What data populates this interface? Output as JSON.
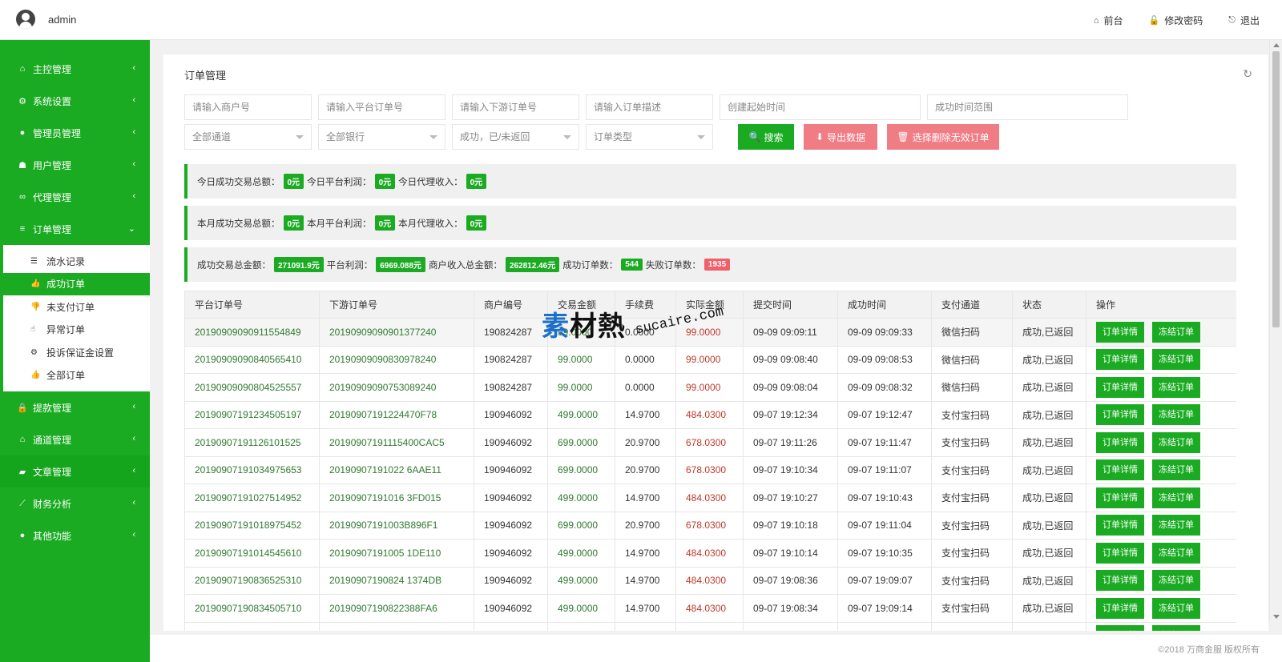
{
  "header": {
    "username": "admin",
    "links": [
      {
        "label": "前台",
        "icon": "home-icon"
      },
      {
        "label": "修改密码",
        "icon": "lock-icon"
      },
      {
        "label": "退出",
        "icon": "logout-icon"
      }
    ]
  },
  "sidebar": {
    "items": [
      {
        "label": "主控管理",
        "icon": "home-icon"
      },
      {
        "label": "系统设置",
        "icon": "gears-icon"
      },
      {
        "label": "管理员管理",
        "icon": "user-circle-icon"
      },
      {
        "label": "用户管理",
        "icon": "users-icon"
      },
      {
        "label": "代理管理",
        "icon": "handshake-icon"
      },
      {
        "label": "订单管理",
        "icon": "list-icon"
      },
      {
        "label": "提款管理",
        "icon": "lock-icon"
      },
      {
        "label": "通道管理",
        "icon": "bank-icon"
      },
      {
        "label": "文章管理",
        "icon": "book-icon"
      },
      {
        "label": "财务分析",
        "icon": "line-chart-icon"
      },
      {
        "label": "其他功能",
        "icon": "user-circle-icon"
      }
    ],
    "submenu": [
      {
        "label": "流水记录",
        "icon": "list-alt-icon"
      },
      {
        "label": "成功订单",
        "icon": "thumbs-up-icon"
      },
      {
        "label": "未支付订单",
        "icon": "thumbs-down-icon"
      },
      {
        "label": "异常订单",
        "icon": "thumbs-o-up-icon"
      },
      {
        "label": "投诉保证金设置",
        "icon": "gear-icon"
      },
      {
        "label": "全部订单",
        "icon": "thumbs-up-icon"
      }
    ]
  },
  "main": {
    "title": "订单管理",
    "filters": {
      "merchant_no": "请输入商户号",
      "platform_order": "请输入平台订单号",
      "downstream_order": "请输入下游订单号",
      "order_desc": "请输入订单描述",
      "create_start": "创建起始时间",
      "success_range": "成功时间范围",
      "channel": "全部通道",
      "bank": "全部银行",
      "status": "成功，已/未返回",
      "order_type": "订单类型"
    },
    "buttons": {
      "search": "搜索",
      "export": "导出数据",
      "delete_invalid": "选择删除无效订单"
    },
    "stats": {
      "today": {
        "l1": "今日成功交易总额：",
        "v1": "0元",
        "l2": "今日平台利润：",
        "v2": "0元",
        "l3": "今日代理收入：",
        "v3": "0元"
      },
      "month": {
        "l1": "本月成功交易总额：",
        "v1": "0元",
        "l2": "本月平台利润：",
        "v2": "0元",
        "l3": "本月代理收入：",
        "v3": "0元"
      },
      "total": {
        "l1": "成功交易总金额：",
        "v1": "271091.9元",
        "l2": "平台利润：",
        "v2": "6969.088元",
        "l3": "商户收入总金额：",
        "v3": "262812.46元",
        "l4": "成功订单数：",
        "v4": "544",
        "l5": "失败订单数：",
        "v5": "1935"
      }
    },
    "table": {
      "headers": [
        "平台订单号",
        "下游订单号",
        "商户编号",
        "交易金额",
        "手续费",
        "实际金额",
        "提交时间",
        "成功时间",
        "支付通道",
        "状态",
        "操作"
      ],
      "detail_label": "订单详情",
      "freeze_label": "冻结订单",
      "rows": [
        {
          "platform": "20190909090911554849",
          "downstream": "20190909090901377240",
          "merchant": "190824287",
          "amount": "99.0000",
          "fee": "0.0000",
          "actual": "99.0000",
          "submit": "09-09 09:09:11",
          "success": "09-09 09:09:33",
          "channel": "微信扫码",
          "status": "成功,已返回"
        },
        {
          "platform": "20190909090840565410",
          "downstream": "20190909090830978240",
          "merchant": "190824287",
          "amount": "99.0000",
          "fee": "0.0000",
          "actual": "99.0000",
          "submit": "09-09 09:08:40",
          "success": "09-09 09:08:53",
          "channel": "微信扫码",
          "status": "成功,已返回"
        },
        {
          "platform": "20190909090804525557",
          "downstream": "20190909090753089240",
          "merchant": "190824287",
          "amount": "99.0000",
          "fee": "0.0000",
          "actual": "99.0000",
          "submit": "09-09 09:08:04",
          "success": "09-09 09:08:32",
          "channel": "微信扫码",
          "status": "成功,已返回"
        },
        {
          "platform": "20190907191234505197",
          "downstream": "20190907191224470F78",
          "merchant": "190946092",
          "amount": "499.0000",
          "fee": "14.9700",
          "actual": "484.0300",
          "submit": "09-07 19:12:34",
          "success": "09-07 19:12:47",
          "channel": "支付宝扫码",
          "status": "成功,已返回"
        },
        {
          "platform": "20190907191126101525",
          "downstream": "20190907191115400CAC5",
          "merchant": "190946092",
          "amount": "699.0000",
          "fee": "20.9700",
          "actual": "678.0300",
          "submit": "09-07 19:11:26",
          "success": "09-07 19:11:47",
          "channel": "支付宝扫码",
          "status": "成功,已返回"
        },
        {
          "platform": "20190907191034975653",
          "downstream": "20190907191022 6AAE11",
          "merchant": "190946092",
          "amount": "699.0000",
          "fee": "20.9700",
          "actual": "678.0300",
          "submit": "09-07 19:10:34",
          "success": "09-07 19:11:07",
          "channel": "支付宝扫码",
          "status": "成功,已返回"
        },
        {
          "platform": "20190907191027514952",
          "downstream": "20190907191016 3FD015",
          "merchant": "190946092",
          "amount": "499.0000",
          "fee": "14.9700",
          "actual": "484.0300",
          "submit": "09-07 19:10:27",
          "success": "09-07 19:10:43",
          "channel": "支付宝扫码",
          "status": "成功,已返回"
        },
        {
          "platform": "20190907191018975452",
          "downstream": "20190907191003B896F1",
          "merchant": "190946092",
          "amount": "699.0000",
          "fee": "20.9700",
          "actual": "678.0300",
          "submit": "09-07 19:10:18",
          "success": "09-07 19:11:04",
          "channel": "支付宝扫码",
          "status": "成功,已返回"
        },
        {
          "platform": "20190907191014545610",
          "downstream": "20190907191005 1DE110",
          "merchant": "190946092",
          "amount": "499.0000",
          "fee": "14.9700",
          "actual": "484.0300",
          "submit": "09-07 19:10:14",
          "success": "09-07 19:10:35",
          "channel": "支付宝扫码",
          "status": "成功,已返回"
        },
        {
          "platform": "20190907190836525310",
          "downstream": "20190907190824 1374DB",
          "merchant": "190946092",
          "amount": "499.0000",
          "fee": "14.9700",
          "actual": "484.0300",
          "submit": "09-07 19:08:36",
          "success": "09-07 19:09:07",
          "channel": "支付宝扫码",
          "status": "成功,已返回"
        },
        {
          "platform": "20190907190834505710",
          "downstream": "20190907190822388FA6",
          "merchant": "190946092",
          "amount": "499.0000",
          "fee": "14.9700",
          "actual": "484.0300",
          "submit": "09-07 19:08:34",
          "success": "09-07 19:09:14",
          "channel": "支付宝扫码",
          "status": "成功,已返回"
        },
        {
          "platform": "",
          "downstream": "",
          "merchant": "",
          "amount": "",
          "fee": "",
          "actual": "",
          "submit": "",
          "success": "",
          "channel": "",
          "status": ""
        }
      ]
    }
  },
  "watermark": {
    "main_a": "素",
    "main_b": "材熱",
    "sub": "sucaire.com"
  },
  "footer": {
    "copyright": "©2018 万商金服 版权所有"
  },
  "colors": {
    "accent": "#1aab22",
    "danger": "#f07c84",
    "badge_red": "#f05f6a",
    "amount_red": "#c0392b"
  }
}
